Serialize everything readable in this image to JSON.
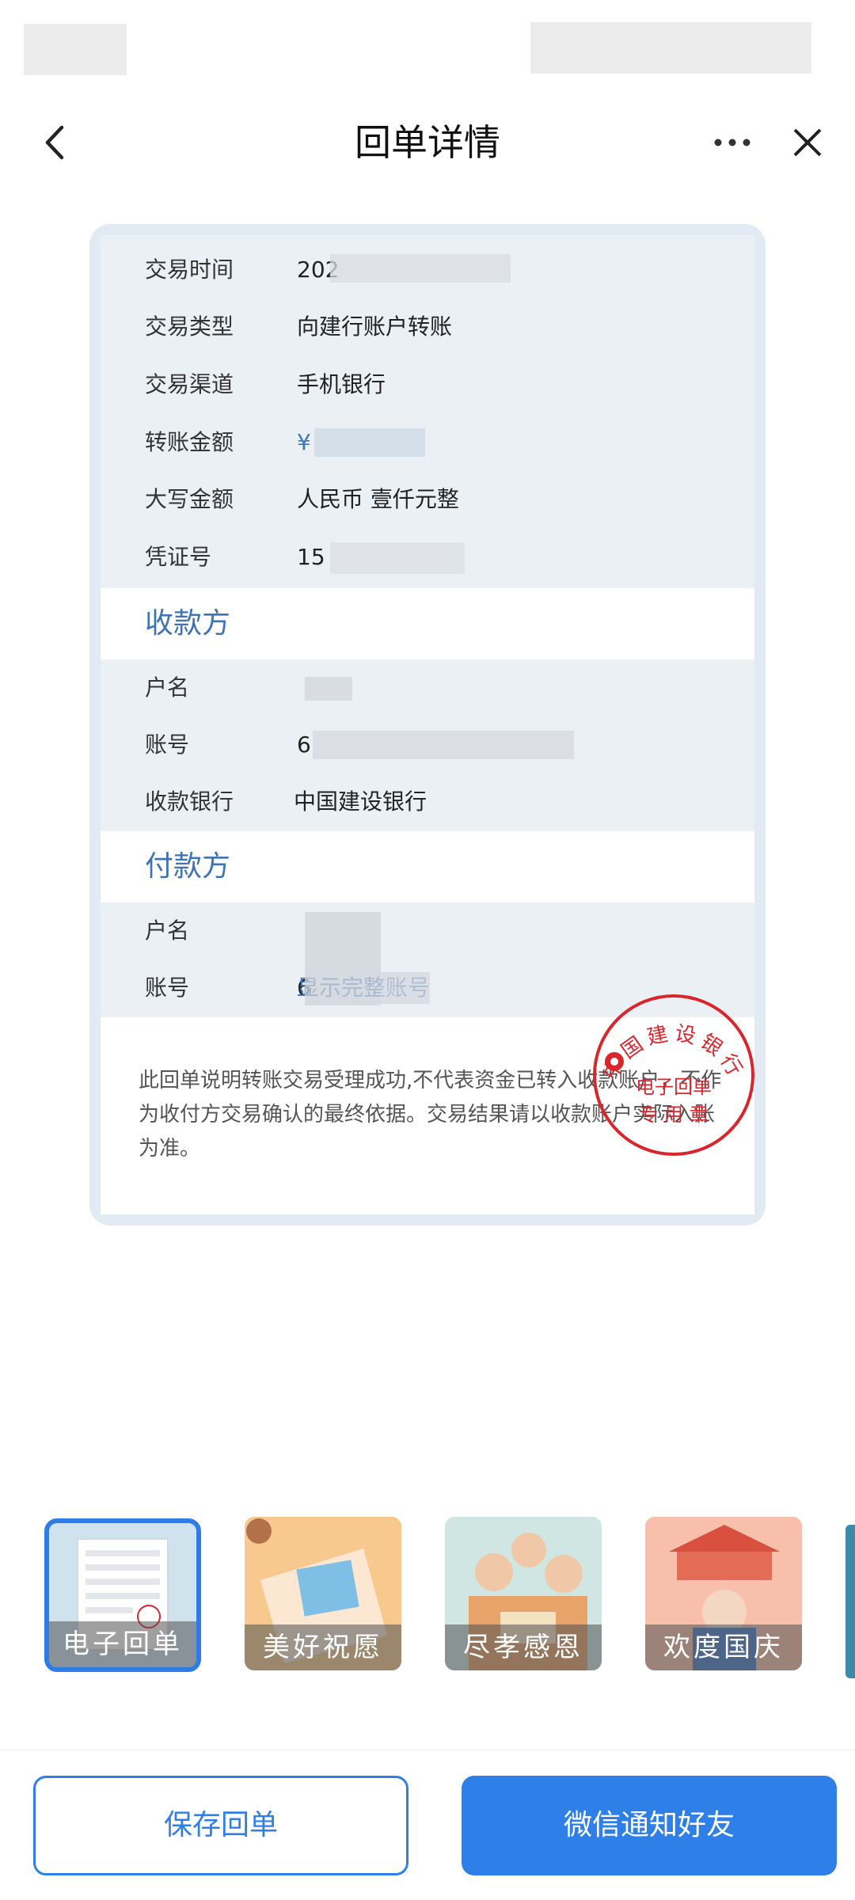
{
  "nav": {
    "title": "回单详情"
  },
  "receipt": {
    "details": [
      {
        "label": "交易时间",
        "value": "202"
      },
      {
        "label": "交易类型",
        "value": "向建行账户转账"
      },
      {
        "label": "交易渠道",
        "value": "手机银行"
      },
      {
        "label": "转账金额",
        "value": "¥"
      },
      {
        "label": "大写金额",
        "value": "人民币 壹仟元整"
      },
      {
        "label": "凭证号",
        "value": "15"
      }
    ],
    "payee": {
      "title": "收款方",
      "rows": [
        {
          "label": "户名",
          "value": ""
        },
        {
          "label": "账号",
          "value": "6"
        },
        {
          "label": "收款银行",
          "value": "中国建设银行"
        }
      ]
    },
    "payer": {
      "title": "付款方",
      "rows": [
        {
          "label": "户名",
          "value": ""
        },
        {
          "label": "账号",
          "value": "6"
        }
      ],
      "show_full_account": "显示完整账号"
    },
    "note": "此回单说明转账交易受理成功,不代表资金已转入收款账户，不作为收付方交易确认的最终依据。交易结果请以收款账户实际入账为准。",
    "seal": {
      "bank_name": "中国建设银行",
      "line1": "电子回单",
      "line2": "专 用 章"
    }
  },
  "themes": [
    {
      "label": "电子回单",
      "selected": true
    },
    {
      "label": "美好祝愿",
      "selected": false
    },
    {
      "label": "尽孝感恩",
      "selected": false
    },
    {
      "label": "欢度国庆",
      "selected": false
    }
  ],
  "actions": {
    "save": "保存回单",
    "share": "微信通知好友"
  },
  "colors": {
    "accent": "#2f7fe8",
    "section_title": "#3d74b5",
    "seal_red": "#d9262c"
  }
}
